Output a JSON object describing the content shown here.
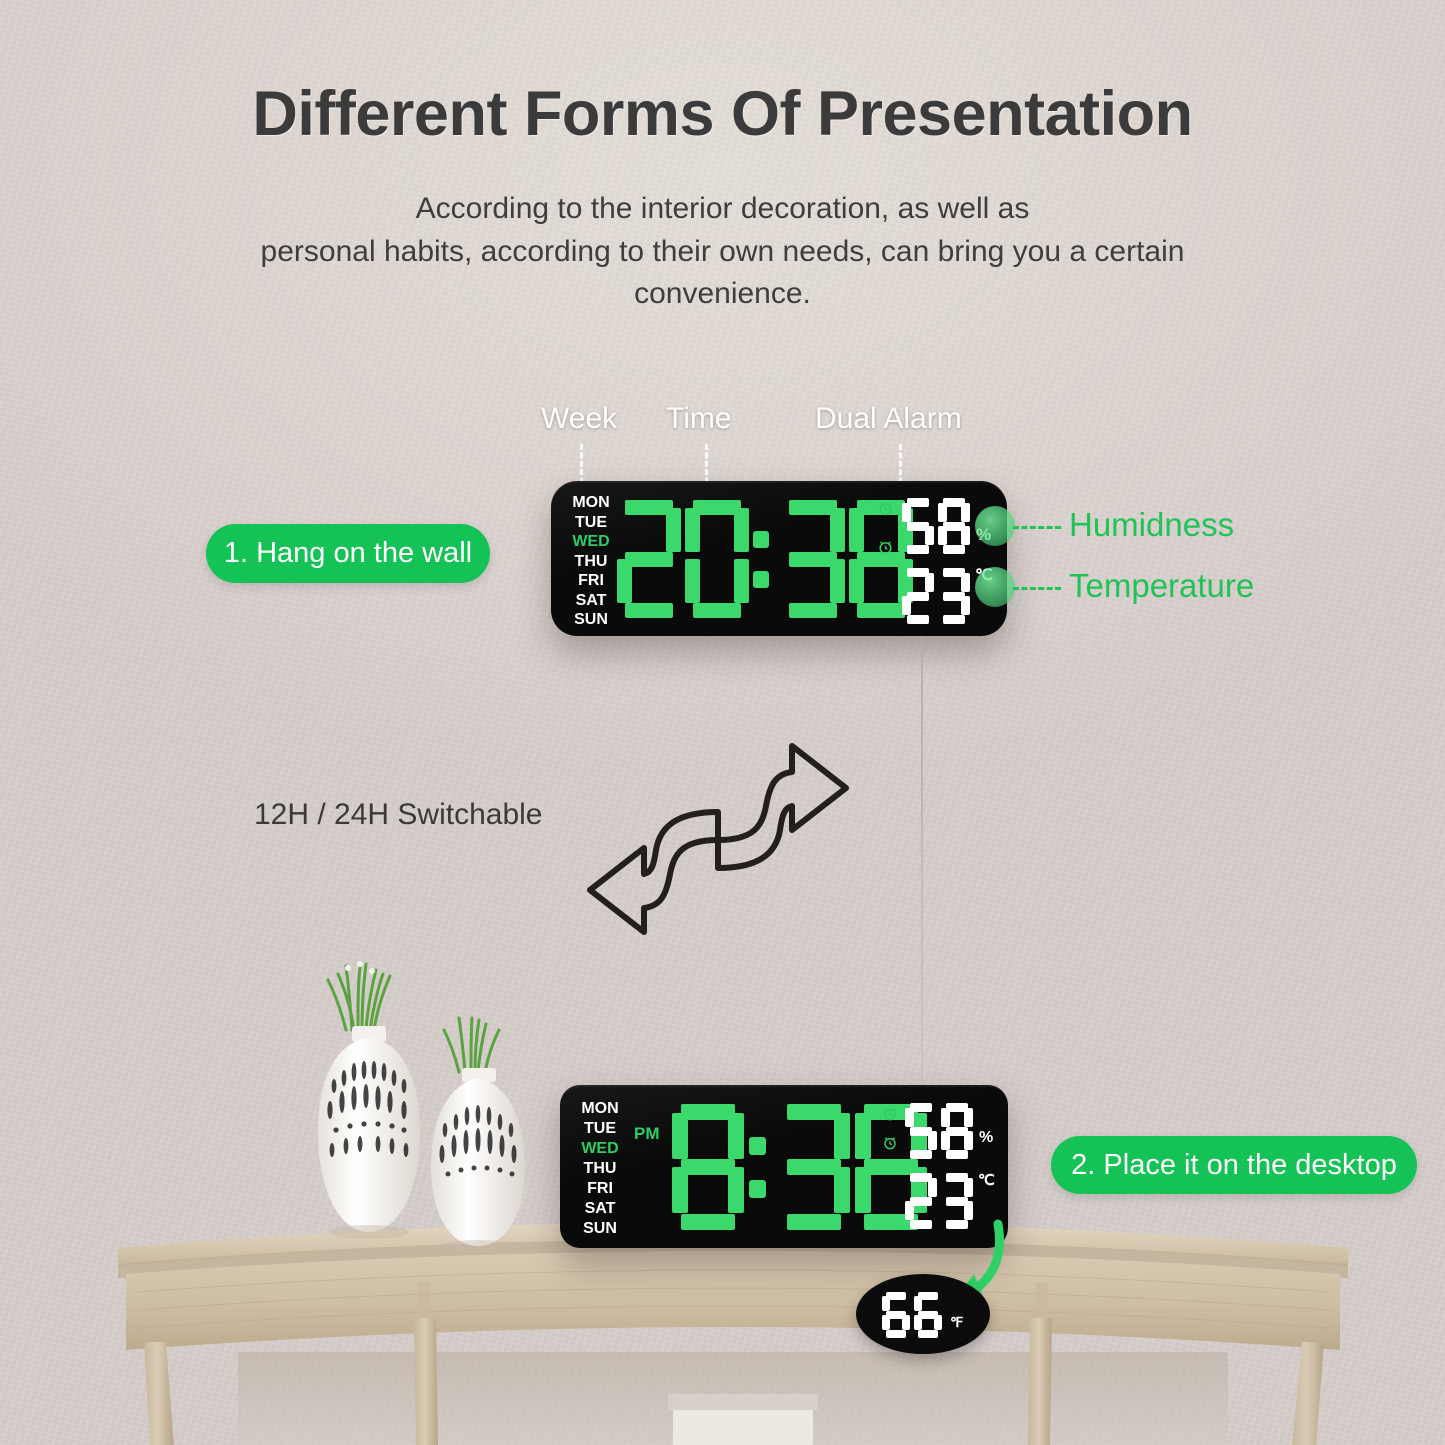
{
  "header": {
    "title": "Different Forms Of Presentation",
    "subtitle_line1": "According to the interior decoration, as well as",
    "subtitle_line2": "personal habits, according to their own needs, can bring you a certain",
    "subtitle_line3": "convenience."
  },
  "callouts": {
    "week": "Week",
    "time": "Time",
    "dual_alarm": "Dual Alarm",
    "humidity": "Humidness",
    "temperature": "Temperature"
  },
  "steps": {
    "step1": "1. Hang on the wall",
    "step2": "2. Place it on the desktop"
  },
  "feature_note": "12H / 24H Switchable",
  "wall_clock": {
    "weekdays": [
      "MON",
      "TUE",
      "WED",
      "THU",
      "FRI",
      "SAT",
      "SUN"
    ],
    "active_day": "WED",
    "time": "20:38",
    "hour": "20",
    "minute": "38",
    "humidity_value": "58",
    "humidity_unit": "%",
    "temperature_value": "23",
    "temperature_unit": "℃",
    "meridiem": "",
    "alarm_icons": 2
  },
  "desk_clock": {
    "weekdays": [
      "MON",
      "TUE",
      "WED",
      "THU",
      "FRI",
      "SAT",
      "SUN"
    ],
    "active_day": "WED",
    "time": "8:38",
    "hour": "8",
    "minute": "38",
    "meridiem": "PM",
    "humidity_value": "58",
    "humidity_unit": "%",
    "temperature_value": "23",
    "temperature_unit": "℃",
    "alarm_icons": 2
  },
  "fahrenheit_badge": {
    "value": "66",
    "unit": "℉"
  },
  "colors": {
    "wall": "#d9d2cf",
    "accent_green": "#15c255",
    "led_green": "#2ecc63",
    "led_white": "#ffffff",
    "clock_body": "#0a0a0a",
    "heading": "#3b3b3b",
    "wood": "#cdbfa8"
  },
  "icons": {
    "alarm": "alarm-clock-icon",
    "arrow_up": "curved-arrow-up-icon",
    "arrow_down": "curved-arrow-down-icon",
    "arrow_green": "green-curved-arrow-icon"
  }
}
